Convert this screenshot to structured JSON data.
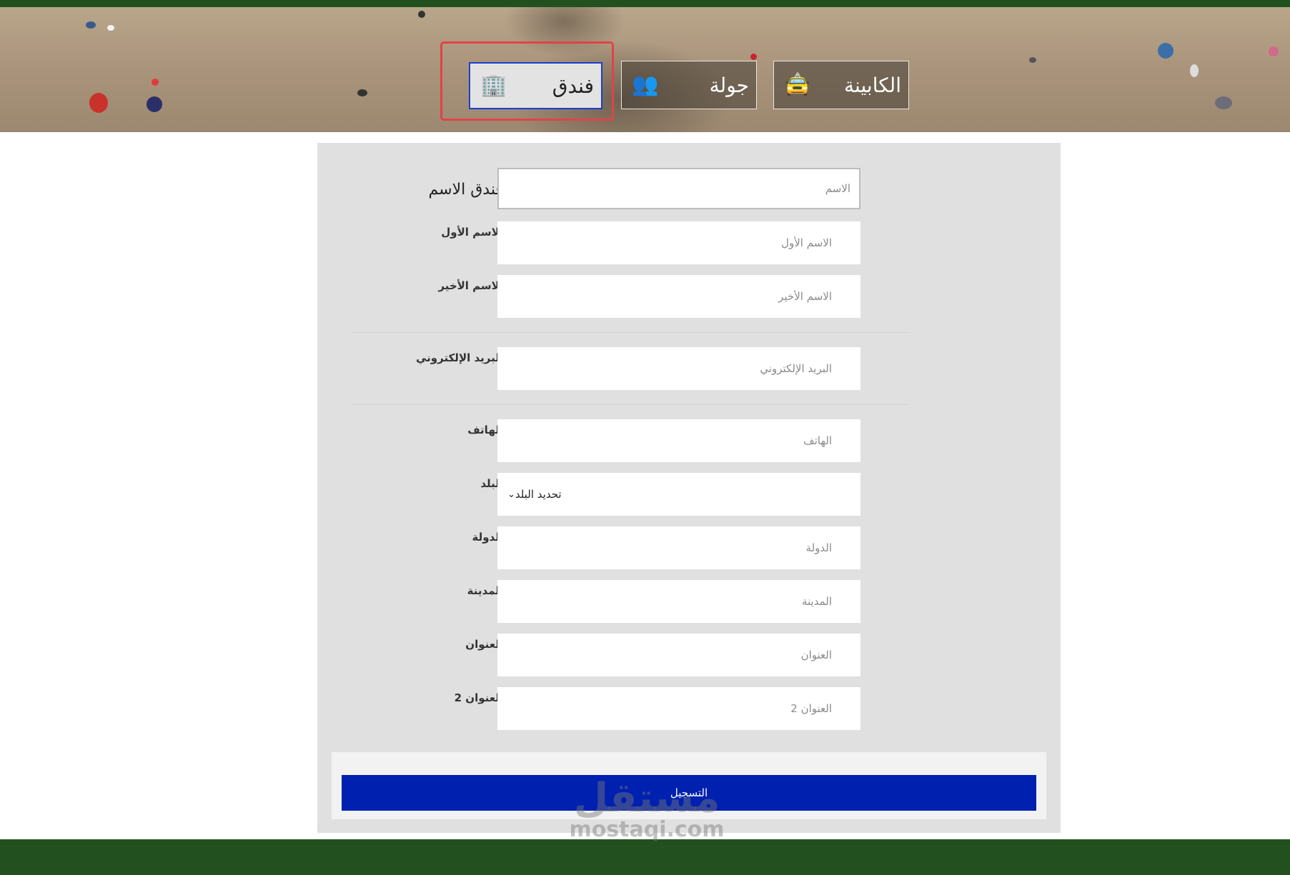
{
  "tabs": [
    {
      "label": "الكابينة",
      "icon": "taxi-icon",
      "active": false
    },
    {
      "label": "جولة",
      "icon": "tour-group-icon",
      "active": false
    },
    {
      "label": "فندق",
      "icon": "hotel-building-icon",
      "active": true
    }
  ],
  "form": {
    "hotel_name_label": "فندق الاسم",
    "hotel_name_placeholder": "الاسم",
    "first_name_label": "الاسم الأول",
    "first_name_placeholder": "الاسم الأول",
    "last_name_label": "الاسم الأخير",
    "last_name_placeholder": "الاسم الأخير",
    "email_label": "البريد الإلكتروني",
    "email_placeholder": "البريد الإلكتروني",
    "phone_label": "الهاتف",
    "phone_placeholder": "الهاتف",
    "country_label": "البلد",
    "country_value": "تحديد البلد",
    "state_label": "الدولة",
    "state_placeholder": "الدولة",
    "city_label": "المدينة",
    "city_placeholder": "المدينة",
    "address_label": "العنوان",
    "address_placeholder": "العنوان",
    "address2_label": "العنوان 2",
    "address2_placeholder": "العنوان 2",
    "submit_label": "التسجيل"
  },
  "watermark": {
    "arabic": "مستقل",
    "latin": "mostaqi.com"
  },
  "colors": {
    "header_footer_green": "#22511f",
    "submit_blue": "#0020b0",
    "highlight_red": "#e0434b",
    "panel_gray": "#e0e0e0"
  }
}
